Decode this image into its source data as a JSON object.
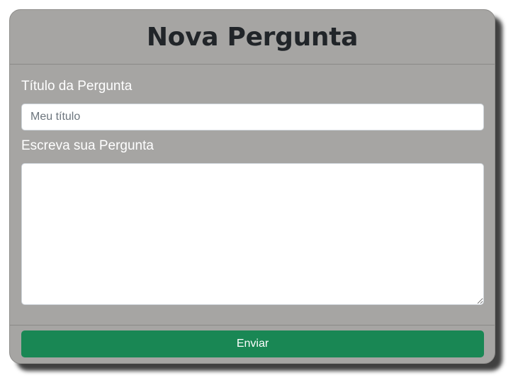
{
  "form": {
    "title": "Nova Pergunta",
    "title_label": "Título da Pergunta",
    "title_placeholder": "Meu título",
    "title_value": "",
    "body_label": "Escreva sua Pergunta",
    "body_value": "",
    "submit_label": "Enviar"
  },
  "colors": {
    "card_background": "#a6a5a3",
    "heading_text": "#212529",
    "label_text": "#ffffff",
    "submit_button": "#198754"
  }
}
